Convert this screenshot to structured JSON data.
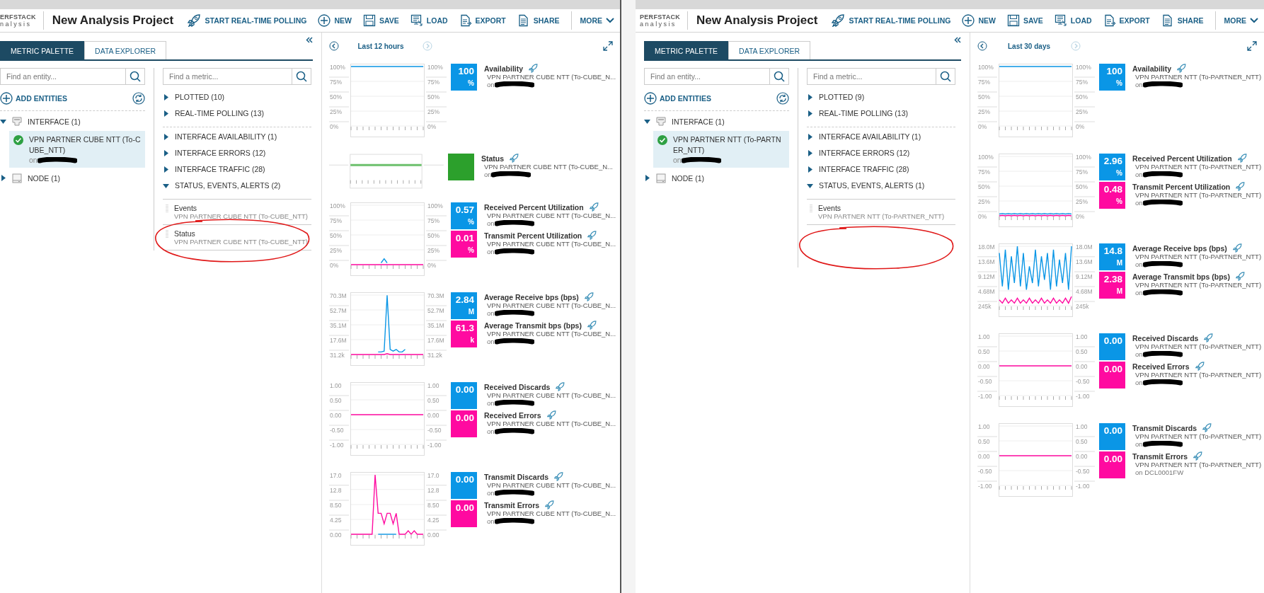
{
  "windows": [
    {
      "clipped_left": true,
      "logo": {
        "top": "ERFSTACK",
        "bottom": "nalysis"
      },
      "title": "New Analysis Project",
      "toolbar": [
        {
          "label": "START REAL-TIME POLLING"
        },
        {
          "label": "NEW"
        },
        {
          "label": "SAVE"
        },
        {
          "label": "LOAD"
        },
        {
          "label": "EXPORT"
        },
        {
          "label": "SHARE"
        }
      ],
      "more": "MORE",
      "tabs": [
        {
          "label": "METRIC PALETTE",
          "selected": true
        },
        {
          "label": "DATA EXPLORER",
          "selected": false
        }
      ],
      "entities": {
        "search": {
          "placeholder": "Find an entity..."
        },
        "add_label": "ADD ENTITIES",
        "tree": [
          {
            "kind": "interface",
            "label": "INTERFACE (1)",
            "expanded": true,
            "children": [
              {
                "name": "VPN PARTNER CUBE NTT (To-CUBE_NTT)",
                "on": "on",
                "redacted": true,
                "selected": true
              }
            ]
          },
          {
            "kind": "node",
            "label": "NODE (1)",
            "expanded": false
          }
        ]
      },
      "metrics": {
        "search": {
          "placeholder": "Find a metric..."
        },
        "groups": [
          {
            "label": "PLOTTED (10)",
            "expanded": false
          },
          {
            "label": "REAL-TIME POLLING (13)",
            "expanded": false,
            "divider_after": true
          },
          {
            "label": "INTERFACE AVAILABILITY (1)",
            "expanded": false
          },
          {
            "label": "INTERFACE ERRORS (12)",
            "expanded": false
          },
          {
            "label": "INTERFACE TRAFFIC (28)",
            "expanded": false
          },
          {
            "label": "STATUS, EVENTS, ALERTS (2)",
            "expanded": true
          }
        ],
        "items": [
          {
            "name": "Events",
            "entity": "VPN PARTNER CUBE NTT (To-CUBE_NTT)"
          },
          {
            "name": "Status",
            "entity": "VPN PARTNER CUBE NTT (To-CUBE_NTT)",
            "circled": true
          }
        ]
      },
      "range": "Last 12 hours",
      "panels": [
        {
          "kind": "chart",
          "chart_data": {
            "type": "line",
            "grid": true,
            "ylim": [
              0,
              100
            ],
            "yticks": [
              {
                "value": 100,
                "label": "100%"
              },
              {
                "value": 75,
                "label": "75%"
              },
              {
                "value": 50,
                "label": "50%"
              },
              {
                "value": 25,
                "label": "25%"
              },
              {
                "value": 0,
                "label": "0%"
              }
            ],
            "series": [
              {
                "color": "#0a96e6",
                "values": [
                  100,
                  100,
                  100,
                  100,
                  100,
                  100,
                  100,
                  100,
                  100,
                  100,
                  100,
                  100,
                  100,
                  100,
                  100,
                  100,
                  100,
                  100,
                  100,
                  100,
                  100,
                  100,
                  100,
                  100,
                  100
                ]
              }
            ]
          },
          "metrics": [
            {
              "name": "Availability",
              "value": "100",
              "unit": "%",
              "color": "#0a96e6",
              "entity": "VPN PARTNER CUBE NTT (To-CUBE_N...",
              "on": "on",
              "redacted": true
            }
          ]
        },
        {
          "kind": "status",
          "metrics": [
            {
              "name": "Status",
              "color": "#2ca02c",
              "entity": "VPN PARTNER CUBE NTT (To-CUBE_N...",
              "on": "on",
              "redacted": true
            }
          ]
        },
        {
          "kind": "chart",
          "chart_data": {
            "type": "line",
            "grid": true,
            "ylim": [
              0,
              100
            ],
            "yticks": [
              {
                "value": 100,
                "label": "100%"
              },
              {
                "value": 75,
                "label": "75%"
              },
              {
                "value": 50,
                "label": "50%"
              },
              {
                "value": 25,
                "label": "25%"
              },
              {
                "value": 0,
                "label": "0%"
              }
            ],
            "series": [
              {
                "color": "#0a96e6",
                "values": [
                  null,
                  null,
                  null,
                  null,
                  null,
                  null,
                  null,
                  null,
                  null,
                  null,
                  3,
                  10,
                  3,
                  null,
                  null,
                  null,
                  null,
                  null,
                  null,
                  null,
                  null,
                  null,
                  null,
                  null,
                  null
                ]
              },
              {
                "color": "#ff0aa0",
                "values": [
                  0,
                  0,
                  0,
                  0,
                  0,
                  0,
                  0,
                  0,
                  0,
                  0,
                  0,
                  0,
                  0,
                  0,
                  0,
                  0,
                  0,
                  0,
                  0,
                  0,
                  0,
                  0,
                  0,
                  0,
                  0
                ]
              }
            ]
          },
          "metrics": [
            {
              "name": "Received Percent Utilization",
              "value": "0.57",
              "unit": "%",
              "color": "#0a96e6",
              "entity": "VPN PARTNER CUBE NTT (To-CUBE_N...",
              "on": "on",
              "redacted": true
            },
            {
              "name": "Transmit Percent Utilization",
              "value": "0.01",
              "unit": "%",
              "color": "#ff0aa0",
              "entity": "VPN PARTNER CUBE NTT (To-CUBE_N...",
              "on": "on",
              "redacted": true
            }
          ]
        },
        {
          "kind": "chart",
          "chart_data": {
            "type": "line",
            "grid": true,
            "ylim": [
              0,
              70300000
            ],
            "yticks": [
              {
                "value": 70300000,
                "label": "70.3M"
              },
              {
                "value": 52700000,
                "label": "52.7M"
              },
              {
                "value": 35100000,
                "label": "35.1M"
              },
              {
                "value": 17600000,
                "label": "17.6M"
              },
              {
                "value": 31200,
                "label": "31.2k"
              }
            ],
            "series": [
              {
                "color": "#0a96e6",
                "values": [
                  null,
                  null,
                  null,
                  null,
                  null,
                  null,
                  null,
                  null,
                  null,
                  3000000,
                  3000000,
                  4000000,
                  70000000,
                  6000000,
                  4000000,
                  6000000,
                  3000000,
                  3000000,
                  6000000,
                  null,
                  null,
                  null,
                  null,
                  null,
                  null
                ]
              },
              {
                "color": "#ff0aa0",
                "values": [
                  0,
                  0,
                  0,
                  0,
                  0,
                  0,
                  0,
                  0,
                  0,
                  0,
                  0,
                  0,
                  1000000,
                  0,
                  0,
                  0,
                  0,
                  0,
                  0,
                  0,
                  0,
                  0,
                  0,
                  0,
                  0
                ]
              }
            ]
          },
          "metrics": [
            {
              "name": "Average Receive bps (bps)",
              "value": "2.84",
              "unit": "M",
              "color": "#0a96e6",
              "entity": "VPN PARTNER CUBE NTT (To-CUBE_N...",
              "on": "on",
              "redacted": true
            },
            {
              "name": "Average Transmit bps (bps)",
              "value": "61.3",
              "unit": "k",
              "color": "#ff0aa0",
              "entity": "VPN PARTNER CUBE NTT (To-CUBE_N...",
              "on": "on",
              "redacted": true
            }
          ]
        },
        {
          "kind": "chart",
          "chart_data": {
            "type": "line",
            "grid": true,
            "ylim": [
              -1,
              1
            ],
            "yticks": [
              {
                "value": 1,
                "label": "1.00"
              },
              {
                "value": 0.5,
                "label": "0.50"
              },
              {
                "value": 0,
                "label": "0.00"
              },
              {
                "value": -0.5,
                "label": "-0.50"
              },
              {
                "value": -1,
                "label": "-1.00"
              }
            ],
            "series": [
              {
                "color": "#ff0aa0",
                "values": [
                  0,
                  0,
                  0,
                  0,
                  0,
                  0,
                  0,
                  0,
                  0,
                  0,
                  0,
                  0,
                  0,
                  0,
                  0,
                  0,
                  0,
                  0,
                  0,
                  0,
                  0,
                  0,
                  0,
                  0,
                  0
                ]
              }
            ]
          },
          "metrics": [
            {
              "name": "Received Discards",
              "value": "0.00",
              "color": "#0a96e6",
              "entity": "VPN PARTNER CUBE NTT (To-CUBE_N...",
              "on": "on",
              "redacted": true
            },
            {
              "name": "Received Errors",
              "value": "0.00",
              "color": "#ff0aa0",
              "entity": "VPN PARTNER CUBE NTT (To-CUBE_N...",
              "on": "on",
              "redacted": true
            }
          ]
        },
        {
          "kind": "chart",
          "chart_data": {
            "type": "line",
            "grid": true,
            "ylim": [
              0,
              17
            ],
            "yticks": [
              {
                "value": 17,
                "label": "17.0"
              },
              {
                "value": 12.8,
                "label": "12.8"
              },
              {
                "value": 8.5,
                "label": "8.50"
              },
              {
                "value": 4.25,
                "label": "4.25"
              },
              {
                "value": 0,
                "label": "0.00"
              }
            ],
            "series": [
              {
                "color": "#0a96e6",
                "values": [
                  null,
                  null,
                  null,
                  null,
                  null,
                  null,
                  null,
                  null,
                  null,
                  0,
                  0,
                  0,
                  0,
                  0,
                  0,
                  0,
                  null,
                  null,
                  null,
                  null,
                  null,
                  null,
                  null,
                  null,
                  null
                ]
              },
              {
                "color": "#ff0aa0",
                "values": [
                  0,
                  0,
                  0,
                  0,
                  0,
                  0,
                  0,
                  0,
                  17,
                  6,
                  6,
                  3,
                  6,
                  6,
                  3,
                  6,
                  0,
                  0,
                  0,
                  1,
                  0,
                  1,
                  0,
                  0,
                  0
                ]
              }
            ]
          },
          "metrics": [
            {
              "name": "Transmit Discards",
              "value": "0.00",
              "color": "#0a96e6",
              "entity": "VPN PARTNER CUBE NTT (To-CUBE_N...",
              "on": "on",
              "redacted": true
            },
            {
              "name": "Transmit Errors",
              "value": "0.00",
              "color": "#ff0aa0",
              "entity": "VPN PARTNER CUBE NTT (To-CUBE_N...",
              "on": "on",
              "redacted": true
            }
          ]
        }
      ]
    },
    {
      "clipped_left": false,
      "logo": {
        "top": "PERFSTACK",
        "bottom": "analysis"
      },
      "title": "New Analysis Project",
      "toolbar": [
        {
          "label": "START REAL-TIME POLLING"
        },
        {
          "label": "NEW"
        },
        {
          "label": "SAVE"
        },
        {
          "label": "LOAD"
        },
        {
          "label": "EXPORT"
        },
        {
          "label": "SHARE"
        }
      ],
      "more": "MORE",
      "tabs": [
        {
          "label": "METRIC PALETTE",
          "selected": true
        },
        {
          "label": "DATA EXPLORER",
          "selected": false
        }
      ],
      "entities": {
        "search": {
          "placeholder": "Find an entity..."
        },
        "add_label": "ADD ENTITIES",
        "tree": [
          {
            "kind": "interface",
            "label": "INTERFACE (1)",
            "expanded": true,
            "children": [
              {
                "name": "VPN PARTNER NTT (To-PARTNER_NTT)",
                "on": "on",
                "redacted": true,
                "selected": true
              }
            ]
          },
          {
            "kind": "node",
            "label": "NODE (1)",
            "expanded": false
          }
        ]
      },
      "metrics": {
        "search": {
          "placeholder": "Find a metric..."
        },
        "groups": [
          {
            "label": "PLOTTED (9)",
            "expanded": false
          },
          {
            "label": "REAL-TIME POLLING (13)",
            "expanded": false,
            "divider_after": true
          },
          {
            "label": "INTERFACE AVAILABILITY (1)",
            "expanded": false
          },
          {
            "label": "INTERFACE ERRORS (12)",
            "expanded": false
          },
          {
            "label": "INTERFACE TRAFFIC (28)",
            "expanded": false
          },
          {
            "label": "STATUS, EVENTS, ALERTS (1)",
            "expanded": true
          }
        ],
        "items": [
          {
            "name": "Events",
            "entity": "VPN PARTNER NTT (To-PARTNER_NTT)"
          }
        ],
        "empty_area_circled": true
      },
      "range": "Last 30 days",
      "panels": [
        {
          "kind": "chart",
          "chart_data": {
            "type": "line",
            "grid": true,
            "ylim": [
              0,
              100
            ],
            "yticks": [
              {
                "value": 100,
                "label": "100%"
              },
              {
                "value": 75,
                "label": "75%"
              },
              {
                "value": 50,
                "label": "50%"
              },
              {
                "value": 25,
                "label": "25%"
              },
              {
                "value": 0,
                "label": "0%"
              }
            ],
            "series": [
              {
                "color": "#0a96e6",
                "values": [
                  100,
                  100,
                  100,
                  100,
                  100,
                  100,
                  100,
                  100,
                  100,
                  100,
                  100,
                  100,
                  100,
                  100,
                  100,
                  100,
                  100,
                  100,
                  100,
                  100,
                  100,
                  100,
                  100,
                  100,
                  100
                ]
              }
            ]
          },
          "metrics": [
            {
              "name": "Availability",
              "value": "100",
              "unit": "%",
              "color": "#0a96e6",
              "entity": "VPN PARTNER NTT (To-PARTNER_NTT)",
              "on": "on",
              "redacted": true
            }
          ]
        },
        {
          "kind": "chart",
          "chart_data": {
            "type": "line",
            "grid": true,
            "ylim": [
              0,
              100
            ],
            "yticks": [
              {
                "value": 100,
                "label": "100%"
              },
              {
                "value": 75,
                "label": "75%"
              },
              {
                "value": 50,
                "label": "50%"
              },
              {
                "value": 25,
                "label": "25%"
              },
              {
                "value": 0,
                "label": "0%"
              }
            ],
            "series": [
              {
                "color": "#0a96e6",
                "values": [
                  3,
                  4,
                  3,
                  4,
                  3,
                  4,
                  3,
                  4,
                  3,
                  4,
                  3,
                  4,
                  3,
                  4,
                  3,
                  4,
                  3,
                  4,
                  3,
                  4,
                  3,
                  4,
                  3,
                  4,
                  3
                ]
              },
              {
                "color": "#ff0aa0",
                "values": [
                  0,
                  1,
                  0,
                  1,
                  0,
                  1,
                  0,
                  1,
                  0,
                  1,
                  0,
                  1,
                  0,
                  1,
                  0,
                  1,
                  0,
                  1,
                  0,
                  1,
                  0,
                  1,
                  0,
                  1,
                  0
                ]
              }
            ]
          },
          "metrics": [
            {
              "name": "Received Percent Utilization",
              "value": "2.96",
              "unit": "%",
              "color": "#0a96e6",
              "entity": "VPN PARTNER NTT (To-PARTNER_NTT)",
              "on": "on",
              "redacted": true
            },
            {
              "name": "Transmit Percent Utilization",
              "value": "0.48",
              "unit": "%",
              "color": "#ff0aa0",
              "entity": "VPN PARTNER NTT (To-PARTNER_NTT)",
              "on": "on",
              "redacted": true
            }
          ]
        },
        {
          "kind": "chart",
          "chart_data": {
            "type": "line",
            "grid": true,
            "ylim": [
              245000,
              18000000
            ],
            "yticks": [
              {
                "value": 18000000,
                "label": "18.0M"
              },
              {
                "value": 13600000,
                "label": "13.6M"
              },
              {
                "value": 9120000,
                "label": "9.12M"
              },
              {
                "value": 4680000,
                "label": "4.68M"
              },
              {
                "value": 245000,
                "label": "245k"
              }
            ],
            "series": [
              {
                "color": "#0a96e6",
                "values": [
                  16000000,
                  6000000,
                  17000000,
                  5000000,
                  15000000,
                  7000000,
                  18000000,
                  6000000,
                  16000000,
                  5000000,
                  12000000,
                  7000000,
                  17000000,
                  6000000,
                  15000000,
                  8000000,
                  16000000,
                  5000000,
                  17000000,
                  6000000,
                  14000000,
                  7000000,
                  16000000,
                  5000000,
                  18000000
                ]
              },
              {
                "color": "#ff0aa0",
                "values": [
                  2000000,
                  1000000,
                  2500000,
                  1000000,
                  2000000,
                  1000000,
                  2500000,
                  1000000,
                  2000000,
                  1000000,
                  2500000,
                  1000000,
                  2000000,
                  1000000,
                  2500000,
                  1000000,
                  2000000,
                  1000000,
                  2500000,
                  1000000,
                  2000000,
                  1000000,
                  2500000,
                  1000000,
                  3000000
                ]
              }
            ]
          },
          "metrics": [
            {
              "name": "Average Receive bps (bps)",
              "value": "14.8",
              "unit": "M",
              "color": "#0a96e6",
              "entity": "VPN PARTNER NTT (To-PARTNER_NTT)",
              "on": "on",
              "redacted": true
            },
            {
              "name": "Average Transmit bps (bps)",
              "value": "2.38",
              "unit": "M",
              "color": "#ff0aa0",
              "entity": "VPN PARTNER NTT (To-PARTNER_NTT)",
              "on": "on",
              "redacted": true
            }
          ]
        },
        {
          "kind": "chart",
          "chart_data": {
            "type": "line",
            "grid": true,
            "ylim": [
              -1,
              1
            ],
            "yticks": [
              {
                "value": 1,
                "label": "1.00"
              },
              {
                "value": 0.5,
                "label": "0.50"
              },
              {
                "value": 0,
                "label": "0.00"
              },
              {
                "value": -0.5,
                "label": "-0.50"
              },
              {
                "value": -1,
                "label": "-1.00"
              }
            ],
            "series": [
              {
                "color": "#ff0aa0",
                "values": [
                  0,
                  0,
                  0,
                  0,
                  0,
                  0,
                  0,
                  0,
                  0,
                  0,
                  0,
                  0,
                  0,
                  0,
                  0,
                  0,
                  0,
                  0,
                  0,
                  0,
                  0,
                  0,
                  0,
                  0,
                  0
                ]
              }
            ]
          },
          "metrics": [
            {
              "name": "Received Discards",
              "value": "0.00",
              "color": "#0a96e6",
              "entity": "VPN PARTNER NTT (To-PARTNER_NTT)",
              "on": "on",
              "redacted": true
            },
            {
              "name": "Received Errors",
              "value": "0.00",
              "color": "#ff0aa0",
              "entity": "VPN PARTNER NTT (To-PARTNER_NTT)",
              "on": "on",
              "redacted": true
            }
          ]
        },
        {
          "kind": "chart",
          "chart_data": {
            "type": "line",
            "grid": true,
            "ylim": [
              -1,
              1
            ],
            "yticks": [
              {
                "value": 1,
                "label": "1.00"
              },
              {
                "value": 0.5,
                "label": "0.50"
              },
              {
                "value": 0,
                "label": "0.00"
              },
              {
                "value": -0.5,
                "label": "-0.50"
              },
              {
                "value": -1,
                "label": "-1.00"
              }
            ],
            "series": [
              {
                "color": "#ff0aa0",
                "values": [
                  0,
                  0,
                  0,
                  0,
                  0,
                  0,
                  0,
                  0,
                  0,
                  0,
                  0,
                  0,
                  0,
                  0,
                  0,
                  0,
                  0,
                  0,
                  0,
                  0,
                  0,
                  0,
                  0,
                  0,
                  0
                ]
              }
            ]
          },
          "metrics": [
            {
              "name": "Transmit Discards",
              "value": "0.00",
              "color": "#0a96e6",
              "entity": "VPN PARTNER NTT (To-PARTNER_NTT)",
              "on": "on",
              "redacted": true
            },
            {
              "name": "Transmit Errors",
              "value": "0.00",
              "color": "#ff0aa0",
              "entity": "VPN PARTNER NTT (To-PARTNER_NTT)",
              "on": "on DCL0001FW",
              "redacted": false
            }
          ]
        }
      ]
    }
  ]
}
